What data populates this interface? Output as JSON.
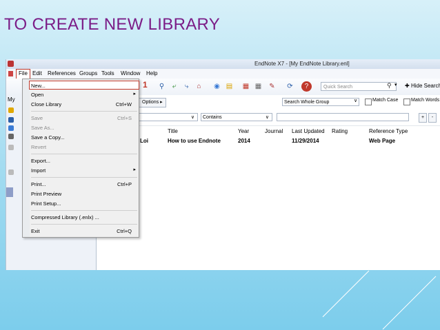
{
  "slide": {
    "title": "TO CREATE NEW LIBRARY"
  },
  "window": {
    "title": "EndNote X7 - [My EndNote Library.enl]"
  },
  "menubar": [
    "File",
    "Edit",
    "References",
    "Groups",
    "Tools",
    "Window",
    "Help"
  ],
  "toolbar": {
    "quick_search_placeholder": "Quick Search",
    "hide_search_label": "Hide Search Fi",
    "icons": [
      "magnifier-icon",
      "arrow-left-icon",
      "arrow-right-icon",
      "home-icon",
      "globe-icon",
      "folder-icon",
      "pdf-icon",
      "grid-icon",
      "edit-icon",
      "sync-icon",
      "help-icon"
    ]
  },
  "left_panel": {
    "label": "My"
  },
  "search": {
    "options_label": "Options",
    "scope": "Search Whole Group",
    "match_case": "Match Case",
    "match_words": "Match Words",
    "condition": "Contains",
    "plus": "+",
    "minus": "-"
  },
  "table": {
    "headers": [
      "Title",
      "Year",
      "Journal",
      "Last Updated",
      "Rating",
      "Reference Type"
    ],
    "rows": [
      {
        "author_fragment": "Loi",
        "title": "How to use Endnote",
        "year": "2014",
        "journal": "",
        "last_updated": "11/29/2014",
        "rating": "",
        "reference_type": "Web Page"
      }
    ]
  },
  "file_menu": {
    "items": [
      {
        "label": "New...",
        "shortcut": "",
        "enabled": true,
        "submenu": false
      },
      {
        "label": "Open",
        "shortcut": "",
        "enabled": true,
        "submenu": true
      },
      {
        "label": "Close Library",
        "shortcut": "Ctrl+W",
        "enabled": true,
        "submenu": false
      },
      {
        "label": "Save",
        "shortcut": "Ctrl+S",
        "enabled": false,
        "submenu": false
      },
      {
        "label": "Save As...",
        "shortcut": "",
        "enabled": false,
        "submenu": false
      },
      {
        "label": "Save a Copy...",
        "shortcut": "",
        "enabled": true,
        "submenu": false
      },
      {
        "label": "Revert",
        "shortcut": "",
        "enabled": false,
        "submenu": false
      },
      {
        "label": "Export...",
        "shortcut": "",
        "enabled": true,
        "submenu": false
      },
      {
        "label": "Import",
        "shortcut": "",
        "enabled": true,
        "submenu": true
      },
      {
        "label": "Print...",
        "shortcut": "Ctrl+P",
        "enabled": true,
        "submenu": false
      },
      {
        "label": "Print Preview",
        "shortcut": "",
        "enabled": true,
        "submenu": false
      },
      {
        "label": "Print Setup...",
        "shortcut": "",
        "enabled": true,
        "submenu": false
      },
      {
        "label": "Compressed Library (.enlx) ...",
        "shortcut": "",
        "enabled": true,
        "submenu": false
      },
      {
        "label": "Exit",
        "shortcut": "Ctrl+Q",
        "enabled": true,
        "submenu": false
      }
    ],
    "callout": "1",
    "highlight_color": "#c0392b"
  }
}
